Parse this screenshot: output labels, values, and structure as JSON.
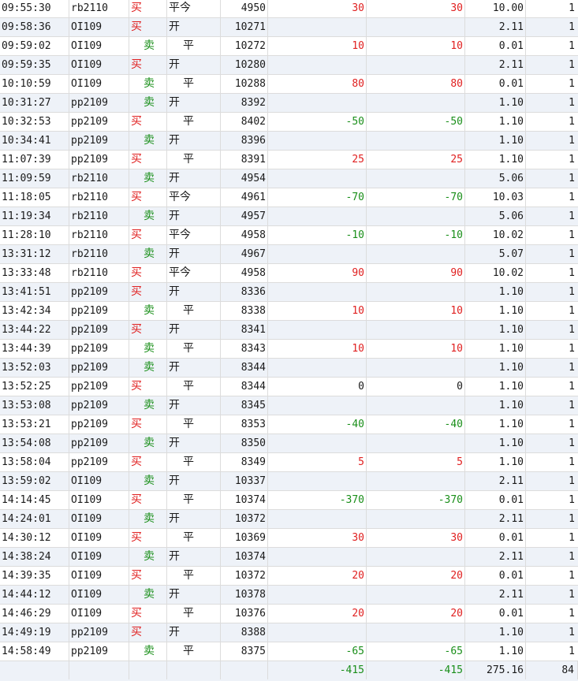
{
  "rows": [
    {
      "time": "09:55:30",
      "symbol": "rb2110",
      "dir": "买",
      "oc": "平今",
      "price": "4950",
      "pnl1": "30",
      "pnl2": "30",
      "fee": "10.00",
      "qty": "1"
    },
    {
      "time": "09:58:36",
      "symbol": "OI109",
      "dir": "买",
      "oc": "开",
      "price": "10271",
      "pnl1": "",
      "pnl2": "",
      "fee": "2.11",
      "qty": "1"
    },
    {
      "time": "09:59:02",
      "symbol": "OI109",
      "dir": "卖",
      "oc": "平",
      "price": "10272",
      "pnl1": "10",
      "pnl2": "10",
      "fee": "0.01",
      "qty": "1"
    },
    {
      "time": "09:59:35",
      "symbol": "OI109",
      "dir": "买",
      "oc": "开",
      "price": "10280",
      "pnl1": "",
      "pnl2": "",
      "fee": "2.11",
      "qty": "1"
    },
    {
      "time": "10:10:59",
      "symbol": "OI109",
      "dir": "卖",
      "oc": "平",
      "price": "10288",
      "pnl1": "80",
      "pnl2": "80",
      "fee": "0.01",
      "qty": "1"
    },
    {
      "time": "10:31:27",
      "symbol": "pp2109",
      "dir": "卖",
      "oc": "开",
      "price": "8392",
      "pnl1": "",
      "pnl2": "",
      "fee": "1.10",
      "qty": "1"
    },
    {
      "time": "10:32:53",
      "symbol": "pp2109",
      "dir": "买",
      "oc": "平",
      "price": "8402",
      "pnl1": "-50",
      "pnl2": "-50",
      "fee": "1.10",
      "qty": "1"
    },
    {
      "time": "10:34:41",
      "symbol": "pp2109",
      "dir": "卖",
      "oc": "开",
      "price": "8396",
      "pnl1": "",
      "pnl2": "",
      "fee": "1.10",
      "qty": "1"
    },
    {
      "time": "11:07:39",
      "symbol": "pp2109",
      "dir": "买",
      "oc": "平",
      "price": "8391",
      "pnl1": "25",
      "pnl2": "25",
      "fee": "1.10",
      "qty": "1"
    },
    {
      "time": "11:09:59",
      "symbol": "rb2110",
      "dir": "卖",
      "oc": "开",
      "price": "4954",
      "pnl1": "",
      "pnl2": "",
      "fee": "5.06",
      "qty": "1"
    },
    {
      "time": "11:18:05",
      "symbol": "rb2110",
      "dir": "买",
      "oc": "平今",
      "price": "4961",
      "pnl1": "-70",
      "pnl2": "-70",
      "fee": "10.03",
      "qty": "1"
    },
    {
      "time": "11:19:34",
      "symbol": "rb2110",
      "dir": "卖",
      "oc": "开",
      "price": "4957",
      "pnl1": "",
      "pnl2": "",
      "fee": "5.06",
      "qty": "1"
    },
    {
      "time": "11:28:10",
      "symbol": "rb2110",
      "dir": "买",
      "oc": "平今",
      "price": "4958",
      "pnl1": "-10",
      "pnl2": "-10",
      "fee": "10.02",
      "qty": "1"
    },
    {
      "time": "13:31:12",
      "symbol": "rb2110",
      "dir": "卖",
      "oc": "开",
      "price": "4967",
      "pnl1": "",
      "pnl2": "",
      "fee": "5.07",
      "qty": "1"
    },
    {
      "time": "13:33:48",
      "symbol": "rb2110",
      "dir": "买",
      "oc": "平今",
      "price": "4958",
      "pnl1": "90",
      "pnl2": "90",
      "fee": "10.02",
      "qty": "1"
    },
    {
      "time": "13:41:51",
      "symbol": "pp2109",
      "dir": "买",
      "oc": "开",
      "price": "8336",
      "pnl1": "",
      "pnl2": "",
      "fee": "1.10",
      "qty": "1"
    },
    {
      "time": "13:42:34",
      "symbol": "pp2109",
      "dir": "卖",
      "oc": "平",
      "price": "8338",
      "pnl1": "10",
      "pnl2": "10",
      "fee": "1.10",
      "qty": "1"
    },
    {
      "time": "13:44:22",
      "symbol": "pp2109",
      "dir": "买",
      "oc": "开",
      "price": "8341",
      "pnl1": "",
      "pnl2": "",
      "fee": "1.10",
      "qty": "1"
    },
    {
      "time": "13:44:39",
      "symbol": "pp2109",
      "dir": "卖",
      "oc": "平",
      "price": "8343",
      "pnl1": "10",
      "pnl2": "10",
      "fee": "1.10",
      "qty": "1"
    },
    {
      "time": "13:52:03",
      "symbol": "pp2109",
      "dir": "卖",
      "oc": "开",
      "price": "8344",
      "pnl1": "",
      "pnl2": "",
      "fee": "1.10",
      "qty": "1"
    },
    {
      "time": "13:52:25",
      "symbol": "pp2109",
      "dir": "买",
      "oc": "平",
      "price": "8344",
      "pnl1": "0",
      "pnl2": "0",
      "fee": "1.10",
      "qty": "1"
    },
    {
      "time": "13:53:08",
      "symbol": "pp2109",
      "dir": "卖",
      "oc": "开",
      "price": "8345",
      "pnl1": "",
      "pnl2": "",
      "fee": "1.10",
      "qty": "1"
    },
    {
      "time": "13:53:21",
      "symbol": "pp2109",
      "dir": "买",
      "oc": "平",
      "price": "8353",
      "pnl1": "-40",
      "pnl2": "-40",
      "fee": "1.10",
      "qty": "1"
    },
    {
      "time": "13:54:08",
      "symbol": "pp2109",
      "dir": "卖",
      "oc": "开",
      "price": "8350",
      "pnl1": "",
      "pnl2": "",
      "fee": "1.10",
      "qty": "1"
    },
    {
      "time": "13:58:04",
      "symbol": "pp2109",
      "dir": "买",
      "oc": "平",
      "price": "8349",
      "pnl1": "5",
      "pnl2": "5",
      "fee": "1.10",
      "qty": "1"
    },
    {
      "time": "13:59:02",
      "symbol": "OI109",
      "dir": "卖",
      "oc": "开",
      "price": "10337",
      "pnl1": "",
      "pnl2": "",
      "fee": "2.11",
      "qty": "1"
    },
    {
      "time": "14:14:45",
      "symbol": "OI109",
      "dir": "买",
      "oc": "平",
      "price": "10374",
      "pnl1": "-370",
      "pnl2": "-370",
      "fee": "0.01",
      "qty": "1"
    },
    {
      "time": "14:24:01",
      "symbol": "OI109",
      "dir": "卖",
      "oc": "开",
      "price": "10372",
      "pnl1": "",
      "pnl2": "",
      "fee": "2.11",
      "qty": "1"
    },
    {
      "time": "14:30:12",
      "symbol": "OI109",
      "dir": "买",
      "oc": "平",
      "price": "10369",
      "pnl1": "30",
      "pnl2": "30",
      "fee": "0.01",
      "qty": "1"
    },
    {
      "time": "14:38:24",
      "symbol": "OI109",
      "dir": "卖",
      "oc": "开",
      "price": "10374",
      "pnl1": "",
      "pnl2": "",
      "fee": "2.11",
      "qty": "1"
    },
    {
      "time": "14:39:35",
      "symbol": "OI109",
      "dir": "买",
      "oc": "平",
      "price": "10372",
      "pnl1": "20",
      "pnl2": "20",
      "fee": "0.01",
      "qty": "1"
    },
    {
      "time": "14:44:12",
      "symbol": "OI109",
      "dir": "卖",
      "oc": "开",
      "price": "10378",
      "pnl1": "",
      "pnl2": "",
      "fee": "2.11",
      "qty": "1"
    },
    {
      "time": "14:46:29",
      "symbol": "OI109",
      "dir": "买",
      "oc": "平",
      "price": "10376",
      "pnl1": "20",
      "pnl2": "20",
      "fee": "0.01",
      "qty": "1"
    },
    {
      "time": "14:49:19",
      "symbol": "pp2109",
      "dir": "买",
      "oc": "开",
      "price": "8388",
      "pnl1": "",
      "pnl2": "",
      "fee": "1.10",
      "qty": "1"
    },
    {
      "time": "14:58:49",
      "symbol": "pp2109",
      "dir": "卖",
      "oc": "平",
      "price": "8375",
      "pnl1": "-65",
      "pnl2": "-65",
      "fee": "1.10",
      "qty": "1"
    }
  ],
  "totals": {
    "pnl1": "-415",
    "pnl2": "-415",
    "fee": "275.16",
    "qty": "84"
  },
  "colors": {
    "buy": "#e02020",
    "sell": "#1a8f1a",
    "positive": "#e02020",
    "negative": "#1a8f1a",
    "row_alt": "#eef2f8",
    "grid_line": "#dcdcdc"
  }
}
